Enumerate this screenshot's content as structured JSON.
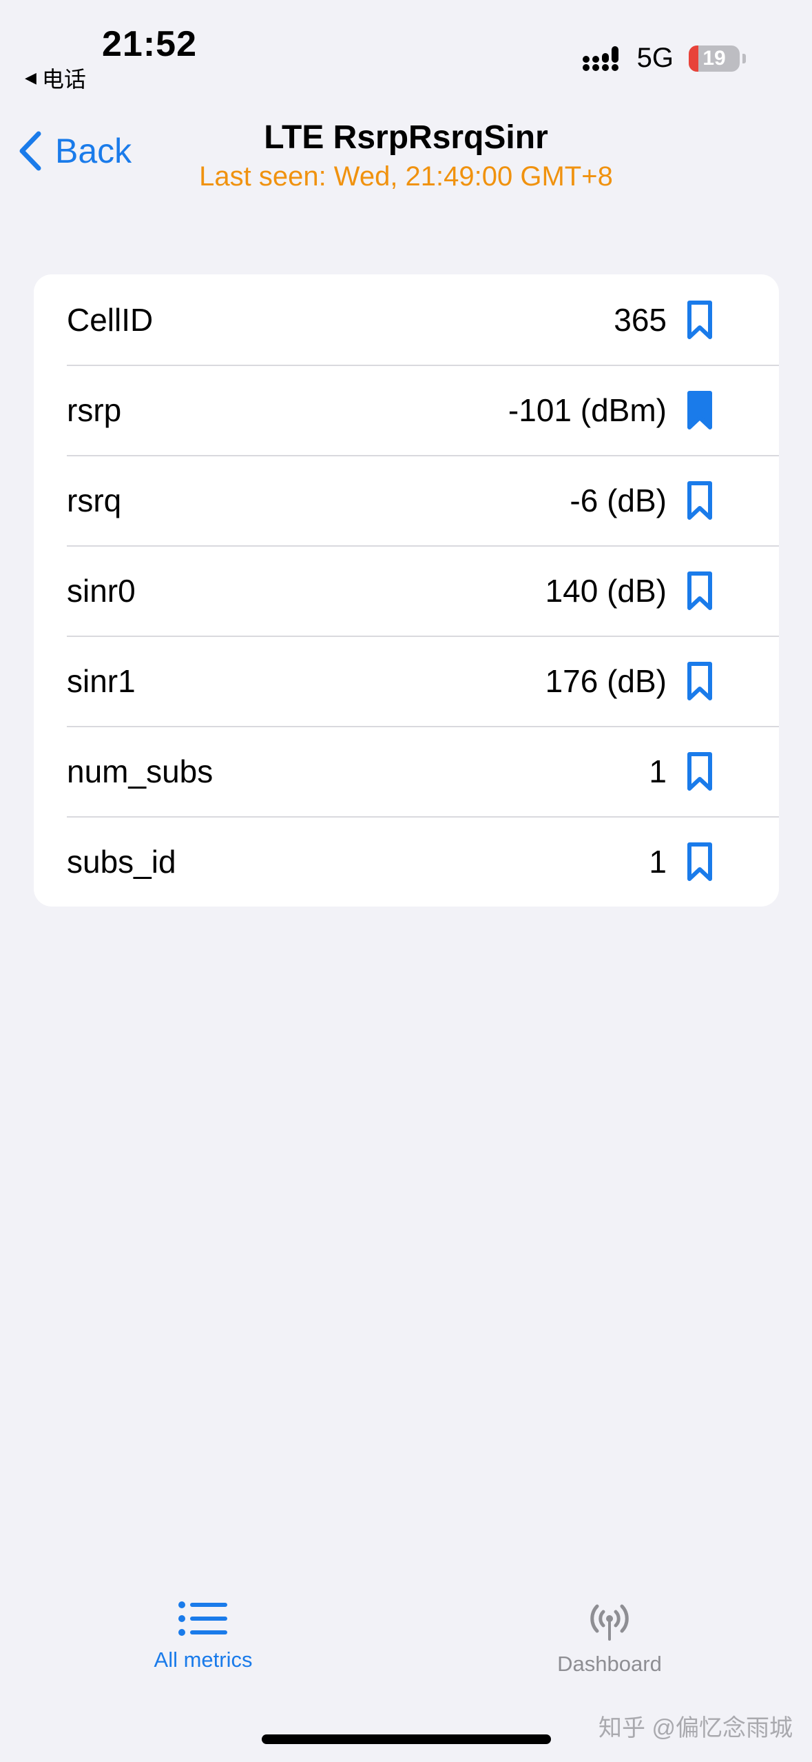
{
  "status_bar": {
    "time": "21:52",
    "back_app": "电话",
    "network": "5G",
    "battery_level": "19",
    "battery_fraction": 0.19
  },
  "nav": {
    "back_label": "Back",
    "title": "LTE RsrpRsrqSinr",
    "subtitle": "Last seen: Wed, 21:49:00 GMT+8"
  },
  "rows": [
    {
      "label": "CellID",
      "value": "365",
      "bookmarked": false
    },
    {
      "label": "rsrp",
      "value": "-101 (dBm)",
      "bookmarked": true
    },
    {
      "label": "rsrq",
      "value": "-6 (dB)",
      "bookmarked": false
    },
    {
      "label": "sinr0",
      "value": "140 (dB)",
      "bookmarked": false
    },
    {
      "label": "sinr1",
      "value": "176 (dB)",
      "bookmarked": false
    },
    {
      "label": "num_subs",
      "value": "1",
      "bookmarked": false
    },
    {
      "label": "subs_id",
      "value": "1",
      "bookmarked": false
    }
  ],
  "tabs": {
    "all_metrics": "All metrics",
    "dashboard": "Dashboard"
  },
  "watermark": "知乎 @偏忆念雨城",
  "colors": {
    "accent": "#1a7bea",
    "subtitle": "#f0920f",
    "inactive_tab": "#8e8e93",
    "battery_low": "#e8433a"
  },
  "icons": {
    "back": "chevron-left-icon",
    "bookmark": "bookmark-icon",
    "all_metrics": "list-icon",
    "dashboard": "antenna-icon"
  }
}
